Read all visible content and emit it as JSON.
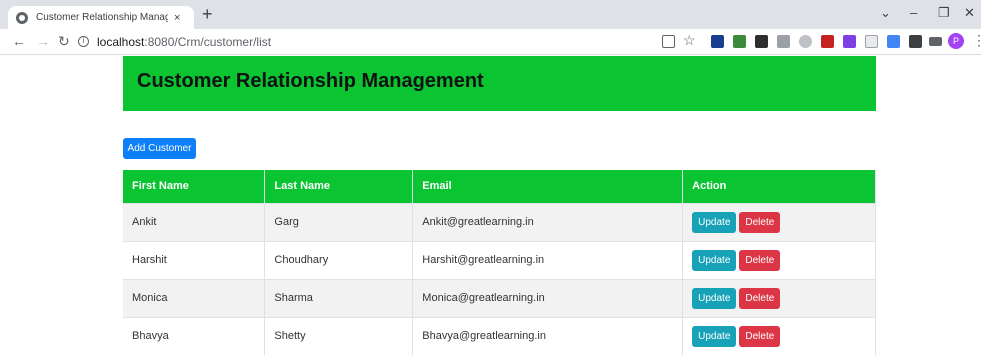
{
  "browser": {
    "tab_title": "Customer Relationship Managemen",
    "tab_close": "×",
    "new_tab": "+",
    "url_host": "localhost",
    "url_path": ":8080/Crm/customer/list",
    "profile_initial": "P"
  },
  "page": {
    "title": "Customer Relationship Management",
    "add_button": "Add Customer"
  },
  "table": {
    "headers": [
      "First Name",
      "Last Name",
      "Email",
      "Action"
    ],
    "rows": [
      {
        "first": "Ankit",
        "last": "Garg",
        "email": "Ankit@greatlearning.in"
      },
      {
        "first": "Harshit",
        "last": "Choudhary",
        "email": "Harshit@greatlearning.in"
      },
      {
        "first": "Monica",
        "last": "Sharma",
        "email": "Monica@greatlearning.in"
      },
      {
        "first": "Bhavya",
        "last": "Shetty",
        "email": "Bhavya@greatlearning.in"
      }
    ],
    "update_label": "Update",
    "delete_label": "Delete"
  },
  "colors": {
    "header_green": "#0bc431",
    "primary_blue": "#0d7ff9",
    "update_teal": "#17a2b8",
    "delete_red": "#dc3545"
  }
}
